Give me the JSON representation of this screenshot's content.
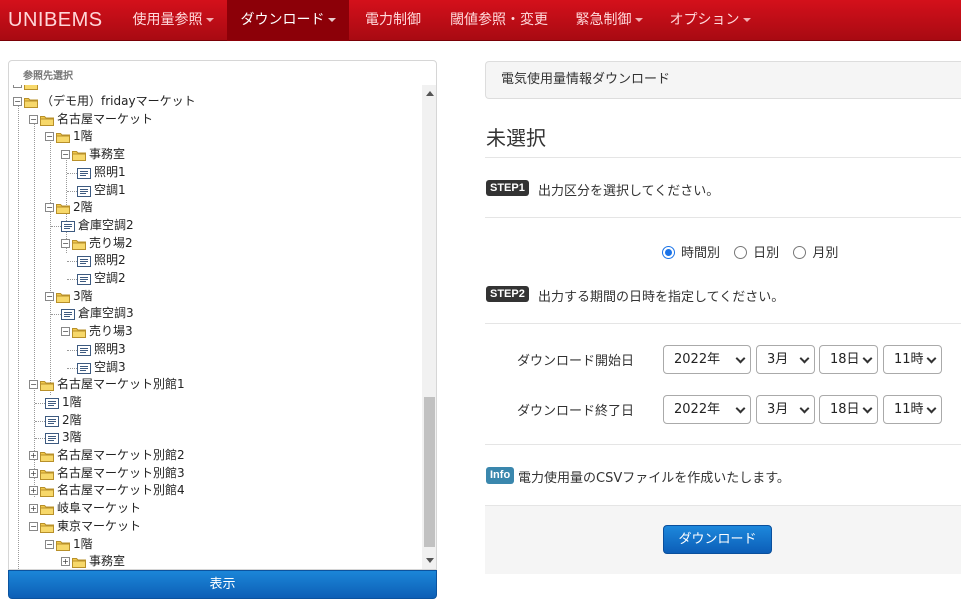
{
  "navbar": {
    "brand": "UNIBEMS",
    "items": [
      {
        "label": "使用量参照",
        "dropdown": true,
        "active": false
      },
      {
        "label": "ダウンロード",
        "dropdown": true,
        "active": true
      },
      {
        "label": "電力制御",
        "dropdown": false,
        "active": false
      },
      {
        "label": "閾値参照・変更",
        "dropdown": false,
        "active": false
      },
      {
        "label": "緊急制御",
        "dropdown": true,
        "active": false
      },
      {
        "label": "オプション",
        "dropdown": true,
        "active": false
      }
    ]
  },
  "tree": {
    "header": "参照先選択",
    "nodes": [
      {
        "label": "（デモ用）fridayマーケット",
        "depth": 0,
        "type": "folder",
        "toggle": "minus"
      },
      {
        "label": "名古屋マーケット",
        "depth": 1,
        "type": "folder",
        "toggle": "minus"
      },
      {
        "label": "1階",
        "depth": 2,
        "type": "folder",
        "toggle": "minus"
      },
      {
        "label": "事務室",
        "depth": 3,
        "type": "folder",
        "toggle": "minus"
      },
      {
        "label": "照明1",
        "depth": 4,
        "type": "node"
      },
      {
        "label": "空調1",
        "depth": 4,
        "type": "node"
      },
      {
        "label": "2階",
        "depth": 2,
        "type": "folder",
        "toggle": "minus"
      },
      {
        "label": "倉庫空調2",
        "depth": 3,
        "type": "node"
      },
      {
        "label": "売り場2",
        "depth": 3,
        "type": "folder",
        "toggle": "minus"
      },
      {
        "label": "照明2",
        "depth": 4,
        "type": "node"
      },
      {
        "label": "空調2",
        "depth": 4,
        "type": "node"
      },
      {
        "label": "3階",
        "depth": 2,
        "type": "folder",
        "toggle": "minus"
      },
      {
        "label": "倉庫空調3",
        "depth": 3,
        "type": "node"
      },
      {
        "label": "売り場3",
        "depth": 3,
        "type": "folder",
        "toggle": "minus"
      },
      {
        "label": "照明3",
        "depth": 4,
        "type": "node"
      },
      {
        "label": "空調3",
        "depth": 4,
        "type": "node"
      },
      {
        "label": "名古屋マーケット別館1",
        "depth": 1,
        "type": "folder",
        "toggle": "minus"
      },
      {
        "label": "1階",
        "depth": 2,
        "type": "node"
      },
      {
        "label": "2階",
        "depth": 2,
        "type": "node"
      },
      {
        "label": "3階",
        "depth": 2,
        "type": "node"
      },
      {
        "label": "名古屋マーケット別館2",
        "depth": 1,
        "type": "folder",
        "toggle": "plus"
      },
      {
        "label": "名古屋マーケット別館3",
        "depth": 1,
        "type": "folder",
        "toggle": "plus"
      },
      {
        "label": "名古屋マーケット別館4",
        "depth": 1,
        "type": "folder",
        "toggle": "plus"
      },
      {
        "label": "岐阜マーケット",
        "depth": 1,
        "type": "folder",
        "toggle": "plus"
      },
      {
        "label": "東京マーケット",
        "depth": 1,
        "type": "folder",
        "toggle": "minus"
      },
      {
        "label": "1階",
        "depth": 2,
        "type": "folder",
        "toggle": "minus"
      },
      {
        "label": "事務室",
        "depth": 3,
        "type": "folder",
        "toggle": "plus"
      }
    ],
    "display_button": "表示"
  },
  "main": {
    "panel_heading": "電気使用量情報ダウンロード",
    "title": "未選択",
    "step1": {
      "badge": "STEP1",
      "text": "出力区分を選択してください。"
    },
    "output_options": [
      {
        "label": "時間別",
        "checked": true
      },
      {
        "label": "日別",
        "checked": false
      },
      {
        "label": "月別",
        "checked": false
      }
    ],
    "step2": {
      "badge": "STEP2",
      "text": "出力する期間の日時を指定してください。"
    },
    "start": {
      "label": "ダウンロード開始日",
      "year": "2022年",
      "month": "3月",
      "day": "18日",
      "hour": "11時"
    },
    "end": {
      "label": "ダウンロード終了日",
      "year": "2022年",
      "month": "3月",
      "day": "18日",
      "hour": "11時"
    },
    "info": {
      "badge": "Info",
      "text": "電力使用量のCSVファイルを作成いたします。"
    },
    "download_button": "ダウンロード"
  },
  "colors": {
    "navbar": "#c40d16",
    "nav_active": "#8c0008",
    "primary_button": "#0d6fc6",
    "info_badge": "#3a87ad",
    "step_badge": "#333333",
    "folder": "#f2c94c"
  }
}
